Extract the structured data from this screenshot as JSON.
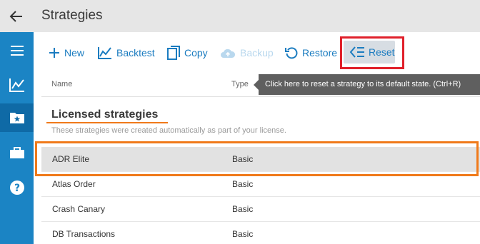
{
  "header": {
    "title": "Strategies"
  },
  "toolbar": {
    "new_label": "New",
    "backtest_label": "Backtest",
    "copy_label": "Copy",
    "backup_label": "Backup",
    "restore_label": "Restore",
    "reset_label": "Reset"
  },
  "tooltip": {
    "text": "Click here to reset a strategy to its default state. (Ctrl+R)"
  },
  "table": {
    "columns": [
      "Name",
      "Type"
    ]
  },
  "group": {
    "title": "Licensed strategies",
    "description": "These strategies were created automatically as part of your license."
  },
  "rows": [
    {
      "name": "ADR Elite",
      "type": "Basic"
    },
    {
      "name": "Atlas Order",
      "type": "Basic"
    },
    {
      "name": "Crash Canary",
      "type": "Basic"
    },
    {
      "name": "DB Transactions",
      "type": "Basic"
    }
  ],
  "colors": {
    "accent": "#1b7cc0",
    "sidebar": "#1b84c4",
    "highlight_red": "#e0202a",
    "highlight_orange": "#f07a1a"
  },
  "icons": [
    "back-arrow-icon",
    "menu-icon",
    "chart-icon",
    "folder-star-icon",
    "briefcase-icon",
    "help-icon",
    "plus-icon",
    "backtest-chart-icon",
    "copy-icon",
    "cloud-upload-icon",
    "restore-icon",
    "reset-icon"
  ]
}
